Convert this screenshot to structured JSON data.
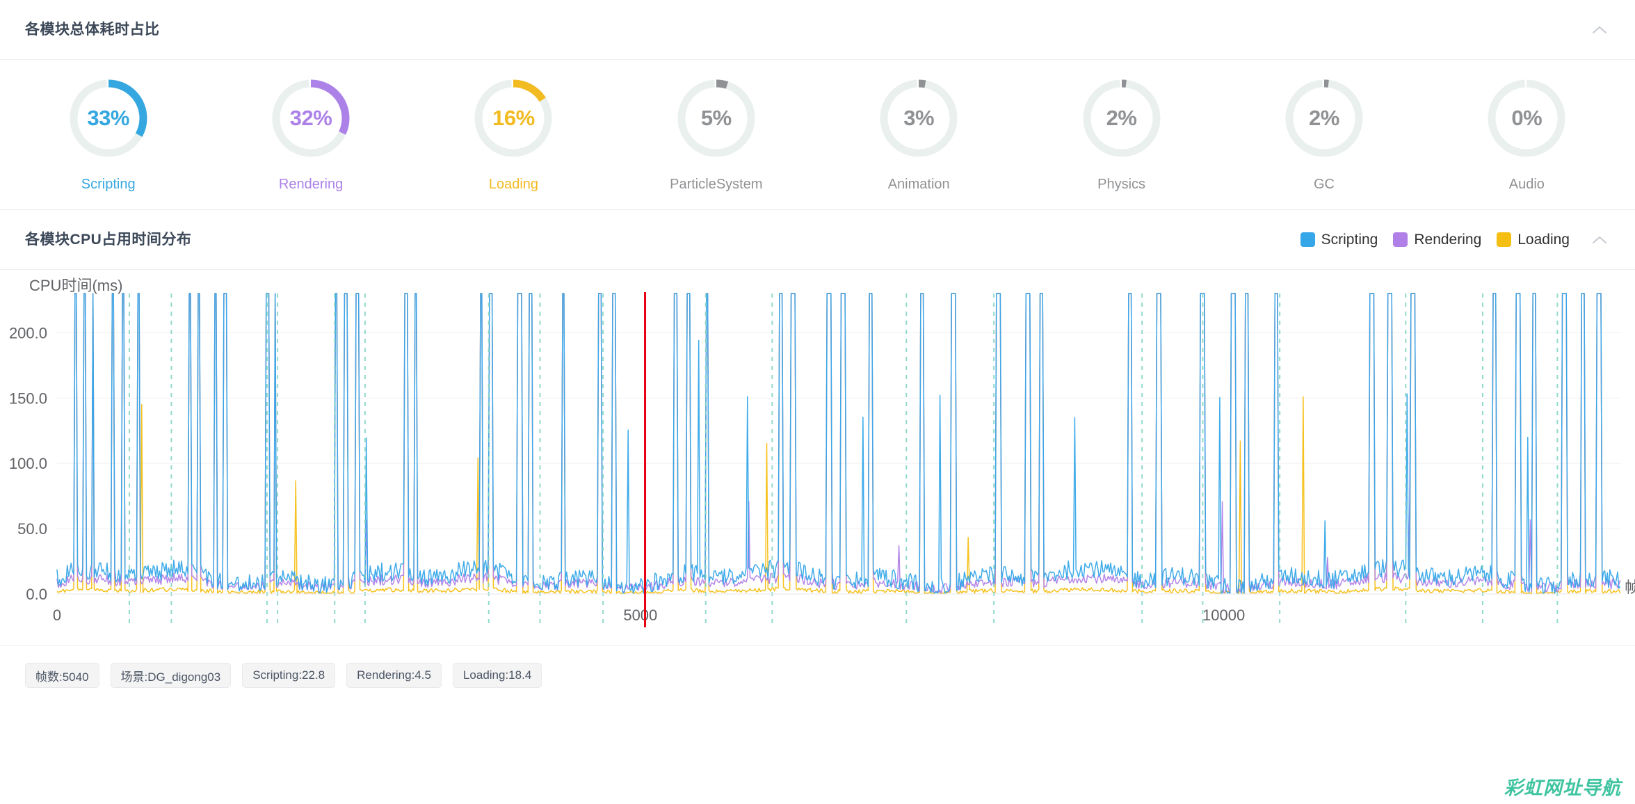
{
  "modules_panel": {
    "title": "各模块总体耗时占比",
    "collapse_icon": "chevron-up-icon",
    "modules": [
      {
        "label": "Scripting",
        "percent_text": "33%",
        "percent": 33,
        "color": "#35a7e0"
      },
      {
        "label": "Rendering",
        "percent_text": "32%",
        "percent": 32,
        "color": "#ac81e8"
      },
      {
        "label": "Loading",
        "percent_text": "16%",
        "percent": 16,
        "color": "#f2bb21"
      },
      {
        "label": "ParticleSystem",
        "percent_text": "5%",
        "percent": 5,
        "color": "#8f9194"
      },
      {
        "label": "Animation",
        "percent_text": "3%",
        "percent": 3,
        "color": "#8f9194"
      },
      {
        "label": "Physics",
        "percent_text": "2%",
        "percent": 2,
        "color": "#8f9194"
      },
      {
        "label": "GC",
        "percent_text": "2%",
        "percent": 2,
        "color": "#8f9194"
      },
      {
        "label": "Audio",
        "percent_text": "0%",
        "percent": 0,
        "color": "#8f9194"
      }
    ],
    "track_color": "#eaf0ee"
  },
  "cpu_panel": {
    "title": "各模块CPU占用时间分布",
    "collapse_icon": "chevron-up-icon",
    "legend": [
      {
        "label": "Scripting",
        "color": "#35a7e8"
      },
      {
        "label": "Rendering",
        "color": "#b07fe8"
      },
      {
        "label": "Loading",
        "color": "#f5be12"
      }
    ]
  },
  "chart_data": {
    "type": "line",
    "title": "各模块CPU占用时间分布",
    "xlabel": "帧数",
    "ylabel": "CPU时间(ms)",
    "xlim": [
      0,
      13400
    ],
    "ylim": [
      0,
      230
    ],
    "xticks": [
      0,
      5000,
      10000
    ],
    "xticklabels": [
      "0",
      "5000",
      "10000"
    ],
    "yticks": [
      0,
      50,
      100,
      150,
      200
    ],
    "yticklabels": [
      "0.0",
      "50.0",
      "100.0",
      "150.0",
      "200.0"
    ],
    "grid": true,
    "legend_position": "top-right",
    "cursor": {
      "frame": 5040,
      "color": "#e60012",
      "label": "帧数:5040"
    },
    "scene_markers_color": "#7fd4c4",
    "scene_marker_frames": [
      620,
      980,
      1800,
      1890,
      2380,
      2640,
      3700,
      4140,
      4680,
      5560,
      6130,
      7280,
      8030,
      9300,
      9820,
      10480,
      11560,
      12220,
      12860
    ],
    "series": [
      {
        "name": "Scripting",
        "color": "#35a7e8",
        "avg": 22.8,
        "peak": 230
      },
      {
        "name": "Rendering",
        "color": "#b07fe8",
        "avg": 4.5,
        "peak": 230
      },
      {
        "name": "Loading",
        "color": "#f5be12",
        "avg": 18.4,
        "peak": 230
      }
    ]
  },
  "status_chips": [
    {
      "name": "frame",
      "text": "帧数:5040"
    },
    {
      "name": "scene",
      "text": "场景:DG_digong03"
    },
    {
      "name": "scripting",
      "text": "Scripting:22.8"
    },
    {
      "name": "rendering",
      "text": "Rendering:4.5"
    },
    {
      "name": "loading",
      "text": "Loading:18.4"
    }
  ],
  "watermark": {
    "text": "彩虹网址导航",
    "color": "#3fc4a0"
  }
}
